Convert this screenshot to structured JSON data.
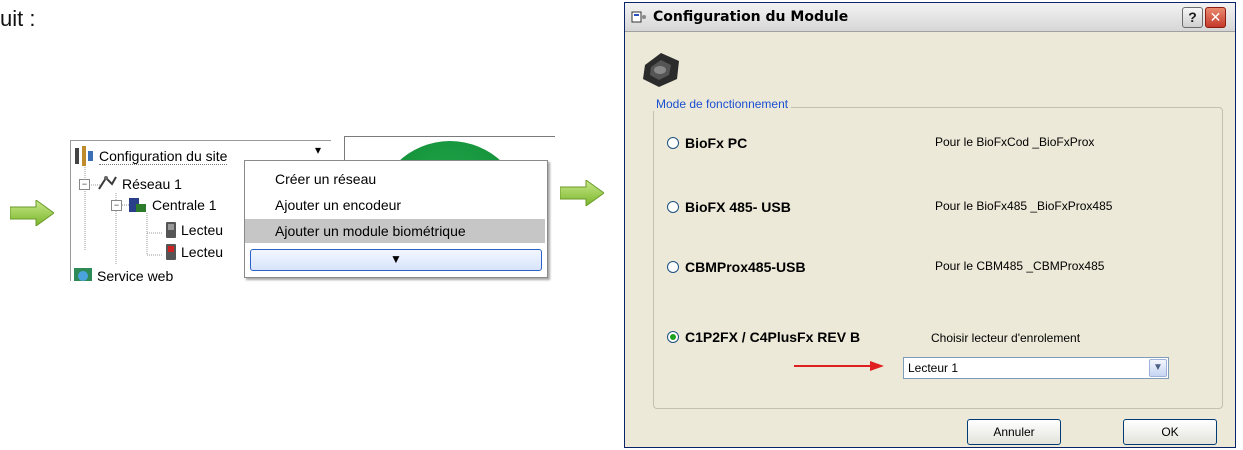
{
  "lead_text": "uit :",
  "tree": {
    "root_label": "Configuration du site",
    "items": [
      {
        "label": "Réseau 1"
      },
      {
        "label": "Centrale 1"
      },
      {
        "label": "Lecteu"
      },
      {
        "label": "Lecteu"
      },
      {
        "label": "Service web"
      }
    ]
  },
  "context_menu": {
    "items": [
      {
        "label": "Créer un réseau"
      },
      {
        "label": "Ajouter un encodeur"
      },
      {
        "label": "Ajouter un module biométrique"
      }
    ],
    "expand_glyph": "▼"
  },
  "dialog": {
    "title": "Configuration du Module",
    "help_glyph": "?",
    "close_glyph": "✕",
    "group_title": "Mode de fonctionnement",
    "options": [
      {
        "label": "BioFx PC",
        "desc": "Pour le BioFxCod _BioFxProx",
        "checked": false
      },
      {
        "label": "BioFX 485- USB",
        "desc": "Pour le BioFx485 _BioFxProx485",
        "checked": false
      },
      {
        "label": "CBMProx485-USB",
        "desc": "Pour le CBM485 _CBMProx485",
        "checked": false
      },
      {
        "label": "C1P2FX / C4PlusFx REV B",
        "desc": "Choisir lecteur d'enrolement",
        "checked": true
      }
    ],
    "reader_select": {
      "value": "Lecteur 1"
    },
    "cancel_label": "Annuler",
    "ok_label": "OK"
  },
  "colors": {
    "group_title": "#1b4fd1",
    "arrow_green": "#8dc63f",
    "arrow_red": "#e02020",
    "menu_highlight": "#c6c6c6"
  }
}
